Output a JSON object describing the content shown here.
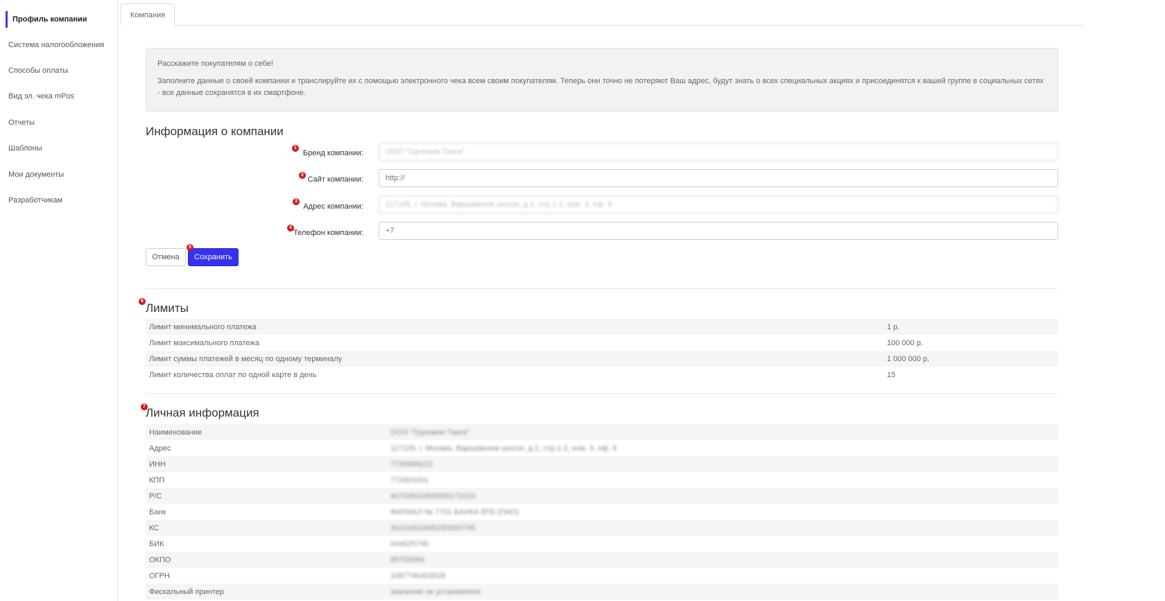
{
  "sidebar": {
    "items": [
      {
        "label": "Профиль компании",
        "active": true
      },
      {
        "label": "Система налогообложения"
      },
      {
        "label": "Способы оплаты"
      },
      {
        "label": "Вид эл. чека mPos"
      },
      {
        "label": "Отчеты"
      },
      {
        "label": "Шаблоны"
      },
      {
        "label": "Мои документы"
      },
      {
        "label": "Разработчикам"
      }
    ]
  },
  "tabs": [
    {
      "label": "Компания"
    }
  ],
  "intro": {
    "headline": "Расскажите покупателям о себе!",
    "body": "Заполните данные о своей компании и транслируйте их с помощью электронного чека всем своим покупателям. Теперь они точно не потеряют Ваш адрес, будут знать о всех специальных акциях и присоединятся к вашей группе в социальных сетях - все данные сохранятся в их смартфоне."
  },
  "company_info": {
    "title": "Информация о компании",
    "fields": [
      {
        "marker": "1",
        "label": "Бренд компании:",
        "value": "ООО \"Грузовое Такси\"",
        "placeholder": ""
      },
      {
        "marker": "2",
        "label": "Сайт компании:",
        "value": "",
        "placeholder": "http://"
      },
      {
        "marker": "3",
        "label": "Адрес компании:",
        "value": "117105, г. Москва, Варшавское шоссе, д.1, стр.1-2, ком. 3, оф. 9",
        "placeholder": ""
      },
      {
        "marker": "4",
        "label": "Телефон компании:",
        "value": "",
        "placeholder": "+7"
      }
    ],
    "cancel_label": "Отмена",
    "save_label": "Сохранить",
    "save_marker": "5"
  },
  "limits": {
    "marker": "6",
    "title": "Лимиты",
    "rows": [
      {
        "label": "Лимит минимального платежа",
        "value": "1 р."
      },
      {
        "label": "Лимит максимального платежа",
        "value": "100 000 р."
      },
      {
        "label": "Лимит суммы платежей в месяц по одному терминалу",
        "value": "1 000 000 р."
      },
      {
        "label": "Лимит количества оплат по одной карте в день",
        "value": "15"
      }
    ]
  },
  "personal": {
    "marker": "7",
    "title": "Личная информация",
    "rows": [
      {
        "label": "Наименование",
        "value": "ООО \"Грузовое Такси\""
      },
      {
        "label": "Адрес",
        "value": "117105, г. Москва, Варшавское шоссе, д.1, стр.1-2, ком. 3, оф. 9"
      },
      {
        "label": "ИНН",
        "value": "7726999222"
      },
      {
        "label": "КПП",
        "value": "772601001"
      },
      {
        "label": "Р/С",
        "value": "40702810300000172010"
      },
      {
        "label": "Банк",
        "value": "ФИЛИАЛ № 7701 БАНКА ВТБ (ПАО)"
      },
      {
        "label": "КС",
        "value": "30101810345250000745"
      },
      {
        "label": "БИК",
        "value": "044525745"
      },
      {
        "label": "ОКПО",
        "value": "85755090"
      },
      {
        "label": "ОГРН",
        "value": "1087746403028"
      },
      {
        "label": "Фискальный принтер",
        "value": "значение не установлено"
      }
    ]
  },
  "colors": {
    "accent": "#3632f0",
    "marker": "#d01b1b",
    "row_shade": "#f4f5f7"
  }
}
